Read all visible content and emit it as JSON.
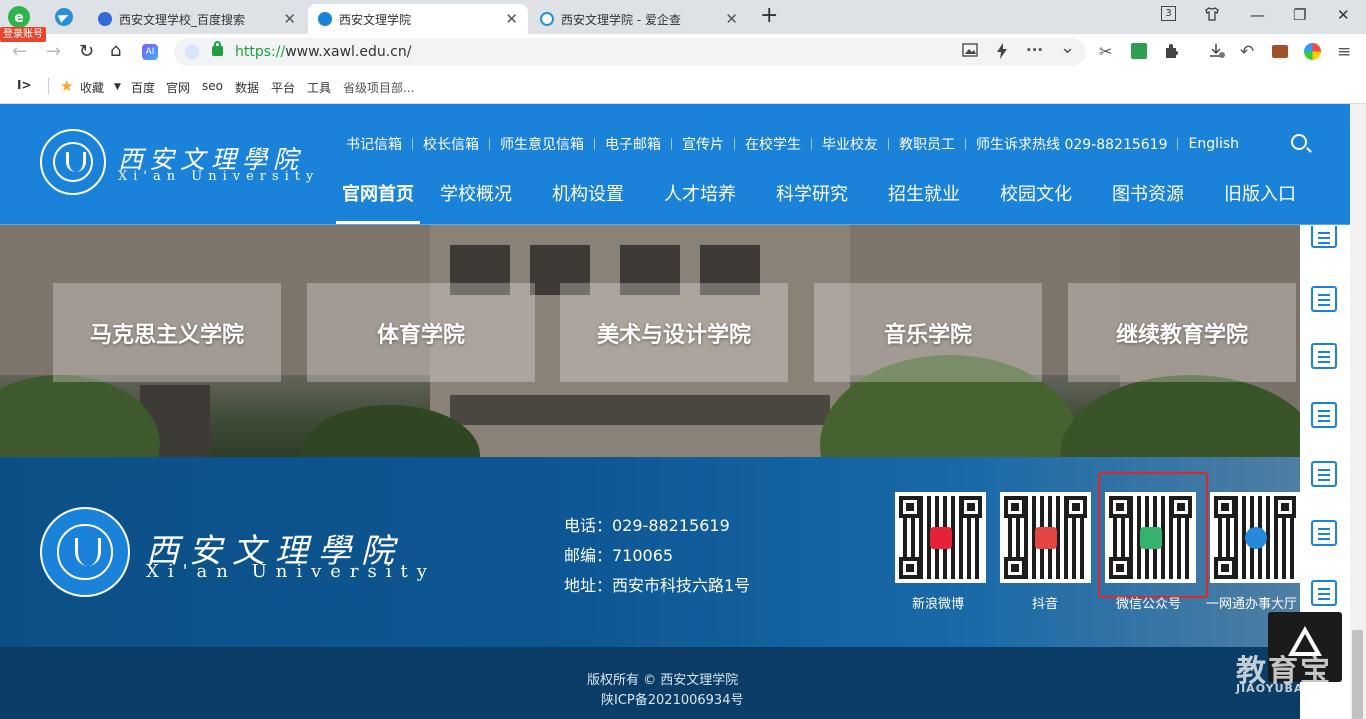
{
  "browser": {
    "login_badge": "登录账号",
    "tabs": [
      {
        "title": "西安文理学校_百度搜索",
        "close": "✕"
      },
      {
        "title": "西安文理学院",
        "close": "✕"
      },
      {
        "title": "西安文理学院 - 爱企查",
        "close": "✕"
      }
    ],
    "new_tab": "+",
    "window_controls": {
      "tab_count": "3",
      "minimize": "—",
      "restore": "❐",
      "close": "✕"
    },
    "nav": {
      "back": "←",
      "forward": "→",
      "reload": "↻",
      "home": "⌂"
    },
    "url_scheme": "https://",
    "url_rest": "www.xawl.edu.cn/",
    "toolbar": {
      "more": "···",
      "dropdown": "⌄",
      "cut": "✂",
      "undo": "↶"
    },
    "bookmarks": {
      "sidebar_toggle": "I>",
      "items": [
        "收藏",
        "百度",
        "官网",
        "seo",
        "数据",
        "平台",
        "工具",
        "省级项目部..."
      ]
    }
  },
  "site": {
    "logo_cn": "西安文理學院",
    "logo_en": "Xi'an University",
    "seal_text": "XI'AN UNIVERSITY",
    "top_links": [
      "书记信箱",
      "校长信箱",
      "师生意见信箱",
      "电子邮箱",
      "宣传片",
      "在校学生",
      "毕业校友",
      "教职员工",
      "师生诉求热线 029-88215619",
      "English"
    ],
    "main_nav": [
      "官网首页",
      "学校概况",
      "机构设置",
      "人才培养",
      "科学研究",
      "招生就业",
      "校园文化",
      "图书资源",
      "旧版入口"
    ],
    "colleges": [
      "马克思主义学院",
      "体育学院",
      "美术与设计学院",
      "音乐学院",
      "继续教育学院"
    ],
    "footer": {
      "phone": "电话：029-88215619",
      "postcode": "邮编：710065",
      "address": "地址：西安市科技六路1号",
      "qr_codes": [
        {
          "label": "新浪微博"
        },
        {
          "label": "抖音"
        },
        {
          "label": "微信公众号"
        },
        {
          "label": "一网通办事大厅"
        }
      ],
      "copyright": "版权所有 © 西安文理学院",
      "icp": "陕ICP备2021006934号"
    },
    "watermark": {
      "cn": "教育宝",
      "en": "JIAOYUBAO.CN"
    }
  },
  "colors": {
    "brand_blue": "#1a82d9",
    "footer_blue": "#0c4f86",
    "highlight_red": "#e0262b"
  }
}
